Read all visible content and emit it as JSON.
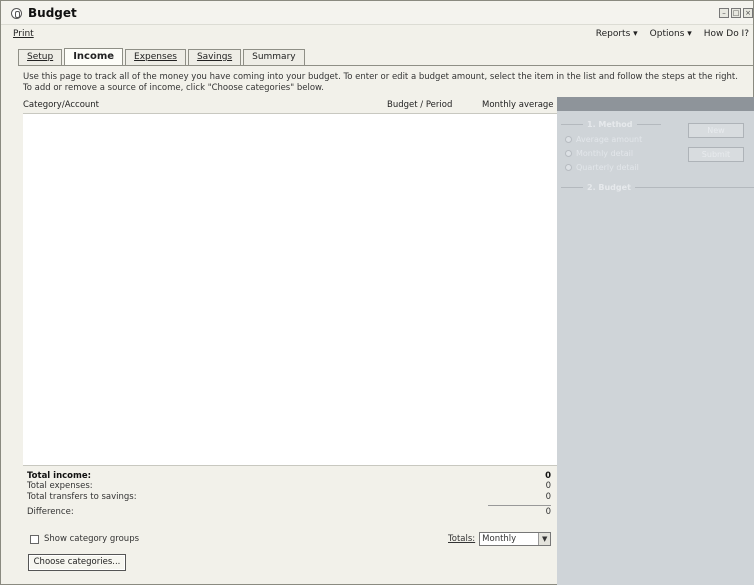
{
  "window": {
    "title": "Budget"
  },
  "menu": {
    "print": "Print",
    "reports": "Reports ▾",
    "options": "Options ▾",
    "help": "How Do I?"
  },
  "tabs": [
    {
      "label": "Setup",
      "active": false
    },
    {
      "label": "Income",
      "active": true
    },
    {
      "label": "Expenses",
      "active": false
    },
    {
      "label": "Savings",
      "active": false
    },
    {
      "label": "Summary",
      "active": false
    }
  ],
  "instructions": "Use this page to track all of the money you have coming into your budget. To enter or edit a budget amount, select the item in the list and follow the steps at the right. To add or remove a source of income, click \"Choose categories\" below.",
  "columns": {
    "category": "Category/Account",
    "budget": "Budget / Period",
    "monthly": "Monthly average"
  },
  "panel": {
    "step1": "1. Method",
    "step2": "2. Budget",
    "options": [
      "Average amount",
      "Monthly detail",
      "Quarterly detail"
    ],
    "new_button": "New",
    "submit_button": "Submit"
  },
  "totals": {
    "income_label": "Total income:",
    "income_value": "0",
    "expenses_label": "Total expenses:",
    "expenses_value": "0",
    "transfers_label": "Total transfers to savings:",
    "transfers_value": "0",
    "difference_label": "Difference:",
    "difference_value": "0"
  },
  "controls": {
    "show_groups": "Show category groups",
    "totals_label": "Totals:",
    "totals_value": "Monthly",
    "choose_button": "Choose categories..."
  }
}
